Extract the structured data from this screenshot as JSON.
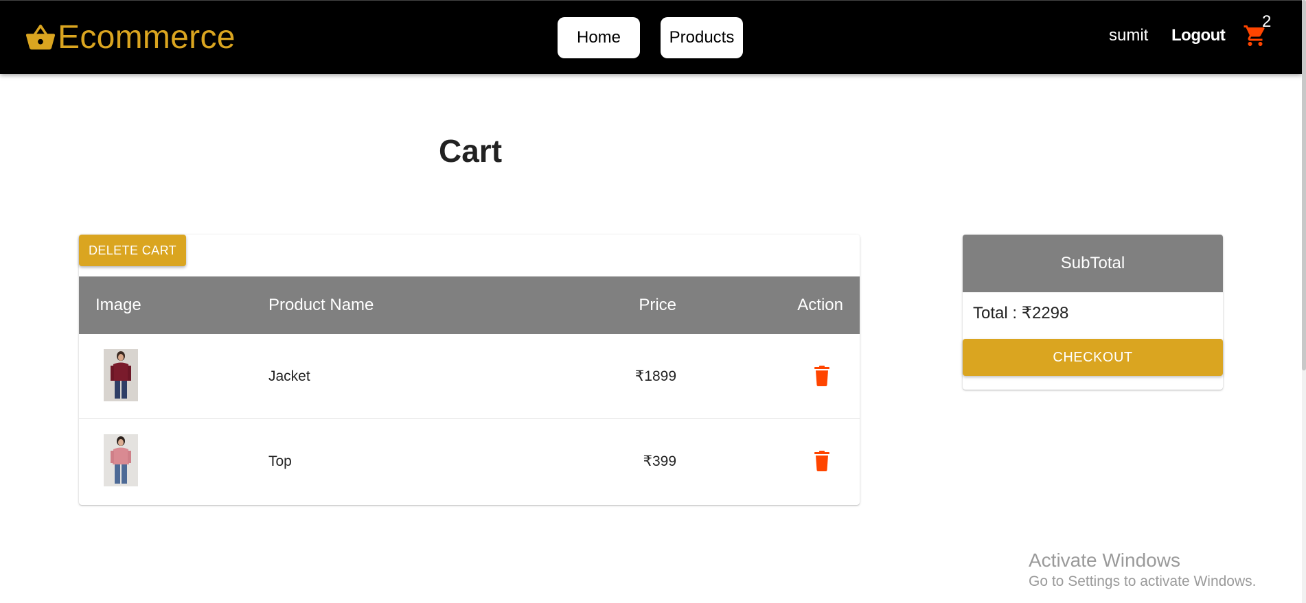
{
  "header": {
    "brand": "Ecommerce",
    "brand_icon": "shopping-basket-icon",
    "nav": {
      "home": "Home",
      "products": "Products"
    },
    "user_name": "sumit",
    "logout": "Logout",
    "cart_icon": "shopping-cart-icon",
    "cart_count": "2"
  },
  "page": {
    "title": "Cart"
  },
  "cart": {
    "delete_label": "DELETE CART",
    "columns": {
      "image": "Image",
      "name": "Product Name",
      "price": "Price",
      "action": "Action"
    },
    "items": [
      {
        "name": "Jacket",
        "price": "₹1899",
        "image": "jacket-product-photo",
        "action_icon": "trash-icon"
      },
      {
        "name": "Top",
        "price": "₹399",
        "image": "top-product-photo",
        "action_icon": "trash-icon"
      }
    ]
  },
  "summary": {
    "header": "SubTotal",
    "total": "Total : ₹2298",
    "checkout_label": "CHECKOUT"
  },
  "watermark": {
    "title": "Activate Windows",
    "subtitle": "Go to Settings to activate Windows."
  },
  "colors": {
    "accent": "#DAA520",
    "header_bg": "#000000",
    "table_header": "#808080",
    "delete_icon": "#FF4500"
  }
}
